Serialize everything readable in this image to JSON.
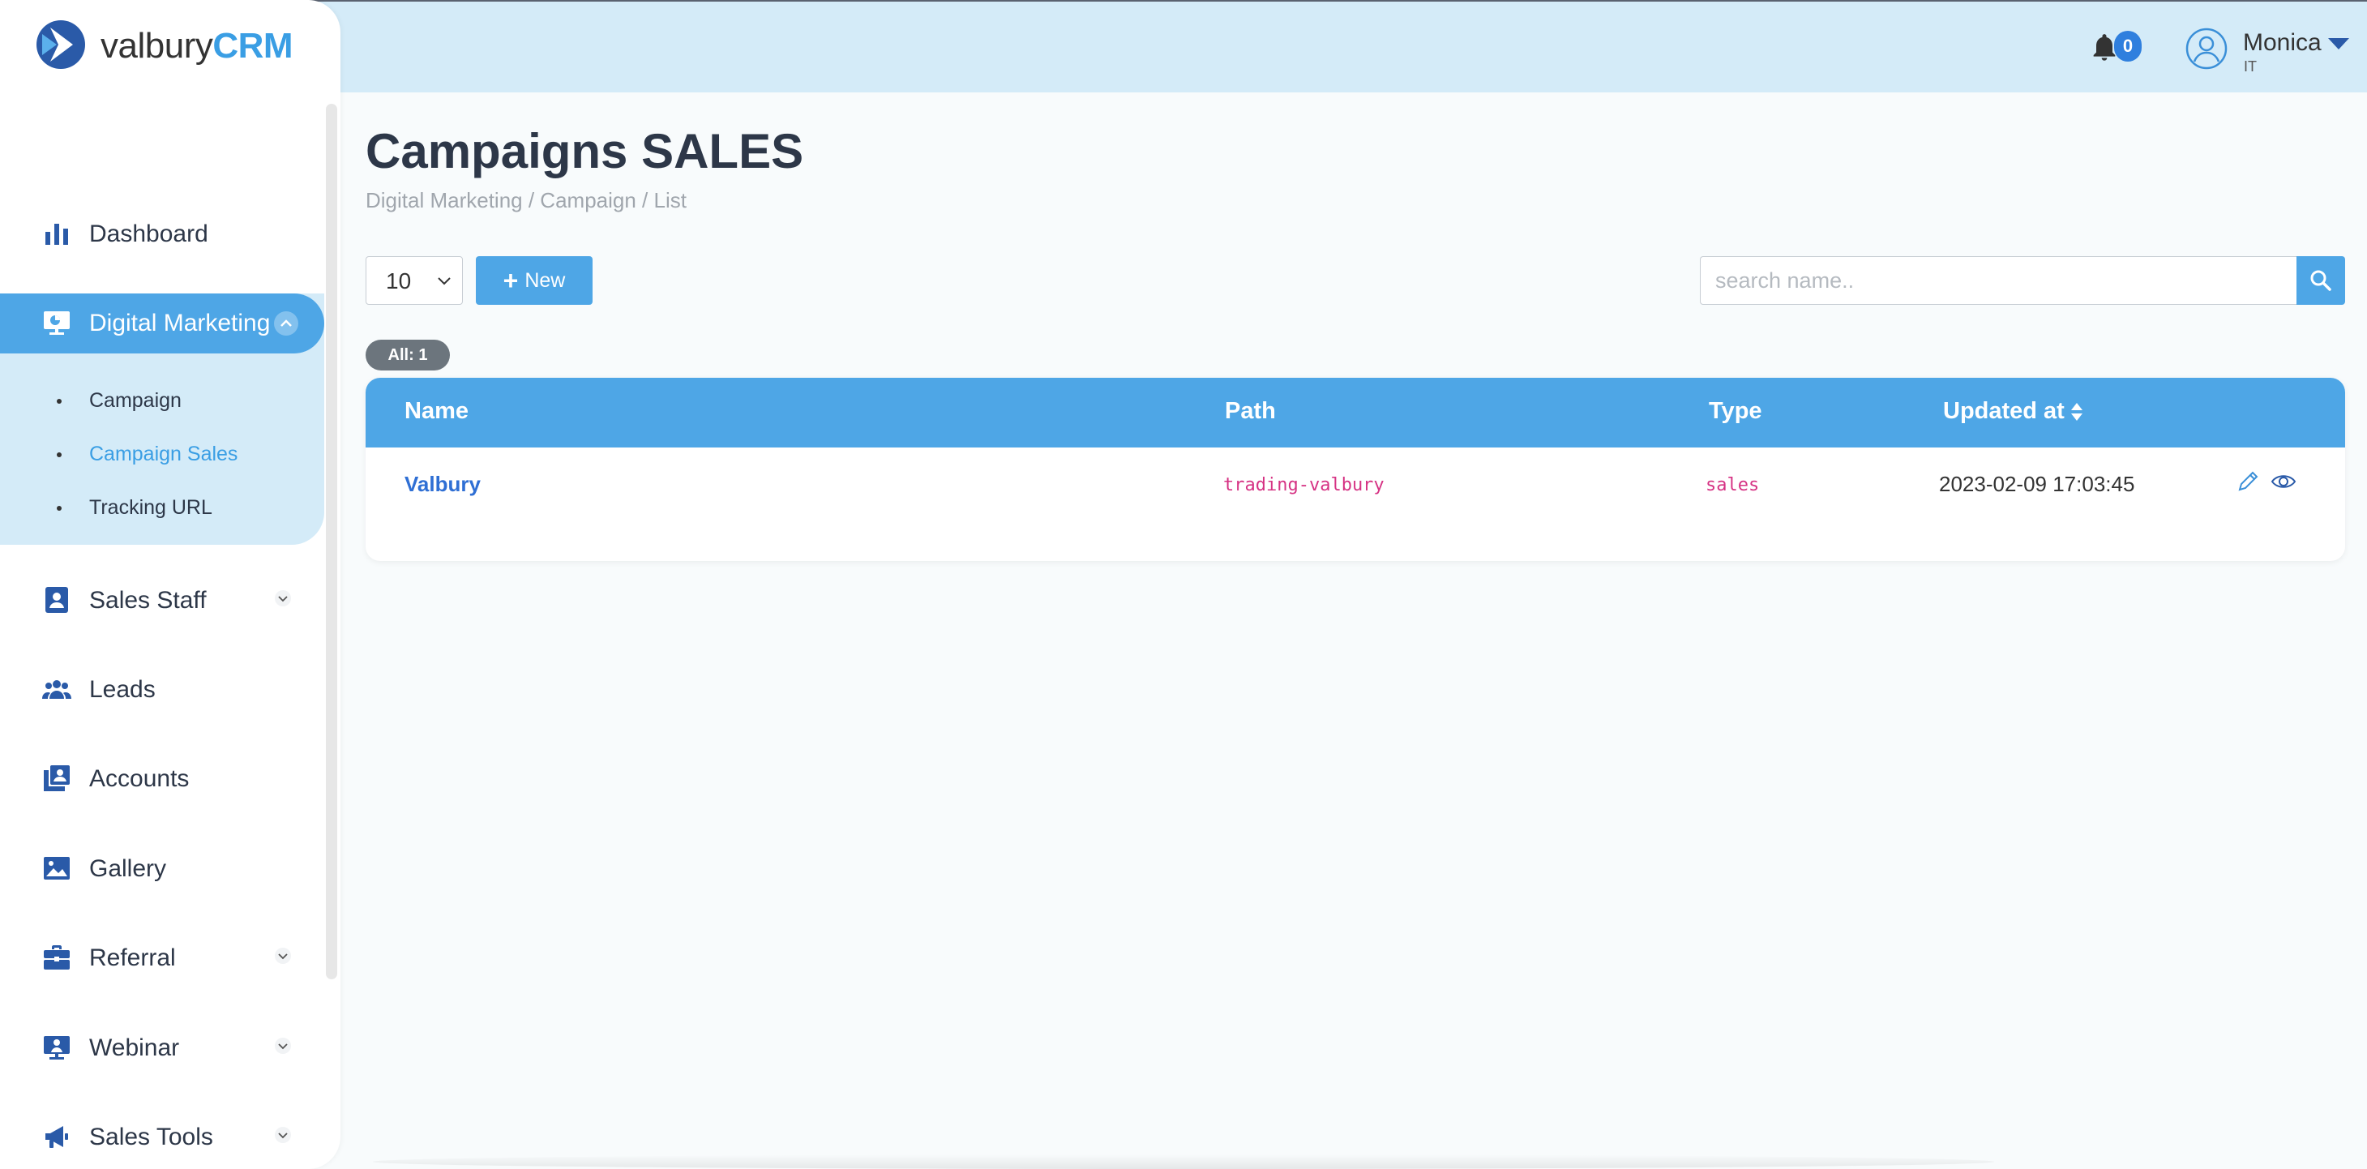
{
  "header": {
    "notifications": {
      "icon": "bell-icon",
      "count": "0"
    },
    "user": {
      "name": "Monica",
      "role": "IT",
      "avatar_icon": "user-circle-icon"
    }
  },
  "sidebar": {
    "logo": {
      "prefix": "valbury",
      "suffix": "CRM"
    },
    "items": [
      {
        "label": "Dashboard",
        "icon": "bar-chart-icon"
      },
      {
        "label": "Digital Marketing",
        "icon": "presentation-chart-icon",
        "expanded": true,
        "children": [
          {
            "label": "Campaign"
          },
          {
            "label": "Campaign Sales",
            "active": true
          },
          {
            "label": "Tracking URL"
          }
        ]
      },
      {
        "label": "Sales Staff",
        "icon": "id-badge-icon"
      },
      {
        "label": "Leads",
        "icon": "users-icon"
      },
      {
        "label": "Accounts",
        "icon": "contacts-icon"
      },
      {
        "label": "Gallery",
        "icon": "image-icon"
      },
      {
        "label": "Referral",
        "icon": "briefcase-icon"
      },
      {
        "label": "Webinar",
        "icon": "webinar-icon"
      },
      {
        "label": "Sales Tools",
        "icon": "megaphone-icon"
      }
    ]
  },
  "main": {
    "title": "Campaigns SALES",
    "breadcrumb": "Digital Marketing / Campaign / List",
    "per_page": "10",
    "new_button": "New",
    "search": {
      "placeholder": "search name.."
    },
    "count_badge": "All: 1",
    "table": {
      "columns": [
        "Name",
        "Path",
        "Type",
        "Updated at"
      ],
      "rows": [
        {
          "name": "Valbury",
          "path": "trading-valbury",
          "type": "sales",
          "updated_at": "2023-02-09 17:03:45"
        }
      ]
    }
  },
  "colors": {
    "accent": "#4ea6e6",
    "header_bg": "#d4ebf8",
    "nav_icon": "#2a5aa8",
    "code_text": "#d63384",
    "link": "#2f6fd4"
  }
}
